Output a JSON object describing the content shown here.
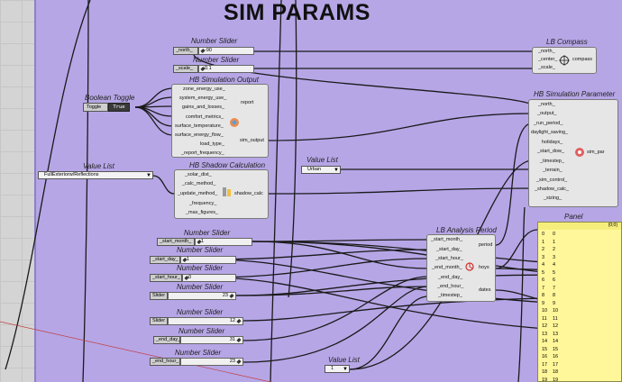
{
  "title": "SIM PARAMS",
  "sliders": [
    {
      "id": "north",
      "caption": "Number Slider",
      "label": "_north_",
      "value": "-90"
    },
    {
      "id": "scale",
      "caption": "Number Slider",
      "label": "_scale_",
      "value": "0.1"
    },
    {
      "id": "start_month",
      "caption": "Number Slider",
      "label": "_start_month_",
      "value": "1"
    },
    {
      "id": "start_day",
      "caption": "Number Slider",
      "label": "_start_day_",
      "value": "1"
    },
    {
      "id": "start_hour",
      "caption": "Number Slider",
      "label": "_start_hour_",
      "value": "0"
    },
    {
      "id": "slider23",
      "caption": "Number Slider",
      "label": "Slider",
      "value": "23"
    },
    {
      "id": "slider12",
      "caption": "Number Slider",
      "label": "Slider",
      "value": "12"
    },
    {
      "id": "end_day",
      "caption": "Number Slider",
      "label": "_end_day_",
      "value": "31"
    },
    {
      "id": "end_hour",
      "caption": "Number Slider",
      "label": "_end_hour_",
      "value": "23"
    }
  ],
  "toggle": {
    "caption": "Boolean Toggle",
    "label": "Toggle",
    "value": "True"
  },
  "value_lists": [
    {
      "id": "shadow",
      "caption": "Value List",
      "value": "FullExteriorw/Reflections"
    },
    {
      "id": "terrain",
      "caption": "Value List",
      "value": "Urban"
    },
    {
      "id": "timestep",
      "caption": "Value List",
      "value": "1"
    }
  ],
  "components": {
    "compass": {
      "caption": "LB Compass",
      "inputs": [
        "_north_",
        "_center_",
        "_scale_"
      ],
      "outputs": [
        "compass"
      ]
    },
    "sim_output": {
      "caption": "HB Simulation Output",
      "inputs": [
        "zone_energy_use_",
        "system_energy_use_",
        "gains_and_losses_",
        "comfort_metrics_",
        "surface_temperature_",
        "surface_energy_flow_",
        "load_type_",
        "_report_frequency_"
      ],
      "outputs": [
        "report",
        "sim_output"
      ]
    },
    "shadow_calc": {
      "caption": "HB Shadow Calculation",
      "inputs": [
        "_solar_dist_",
        "_calc_method_",
        "_update_method_",
        "_frequency_",
        "_max_figures_"
      ],
      "outputs": [
        "shadow_calc"
      ]
    },
    "sim_par": {
      "caption": "HB Simulation Parameter",
      "inputs": [
        "_north_",
        "_output_",
        "_run_period_",
        "daylight_saving_",
        "holidays_",
        "_start_dow_",
        "_timestep_",
        "_terrain_",
        "_sim_control_",
        "_shadow_calc_",
        "_sizing_"
      ],
      "outputs": [
        "sim_par"
      ]
    },
    "analysis_period": {
      "caption": "LB Analysis Period",
      "inputs": [
        "_start_month_",
        "_start_day_",
        "_start_hour_",
        "_end_month_",
        "_end_day_",
        "_end_hour_",
        "_timestep_"
      ],
      "outputs": [
        "period",
        "hoys",
        "dates"
      ]
    }
  },
  "panel": {
    "caption": "Panel",
    "header": "{0;0}",
    "rows": [
      [
        "0",
        "0"
      ],
      [
        "1",
        "1"
      ],
      [
        "2",
        "2"
      ],
      [
        "3",
        "3"
      ],
      [
        "4",
        "4"
      ],
      [
        "5",
        "5"
      ],
      [
        "6",
        "6"
      ],
      [
        "7",
        "7"
      ],
      [
        "8",
        "8"
      ],
      [
        "9",
        "9"
      ],
      [
        "10",
        "10"
      ],
      [
        "11",
        "11"
      ],
      [
        "12",
        "12"
      ],
      [
        "13",
        "13"
      ],
      [
        "14",
        "14"
      ],
      [
        "15",
        "15"
      ],
      [
        "16",
        "16"
      ],
      [
        "17",
        "17"
      ],
      [
        "18",
        "18"
      ],
      [
        "19",
        "19"
      ]
    ]
  },
  "colors": {
    "group_bg": "#b6a6e6",
    "panel_bg": "#fff79a",
    "toggle_true": "#3a3a3a"
  }
}
